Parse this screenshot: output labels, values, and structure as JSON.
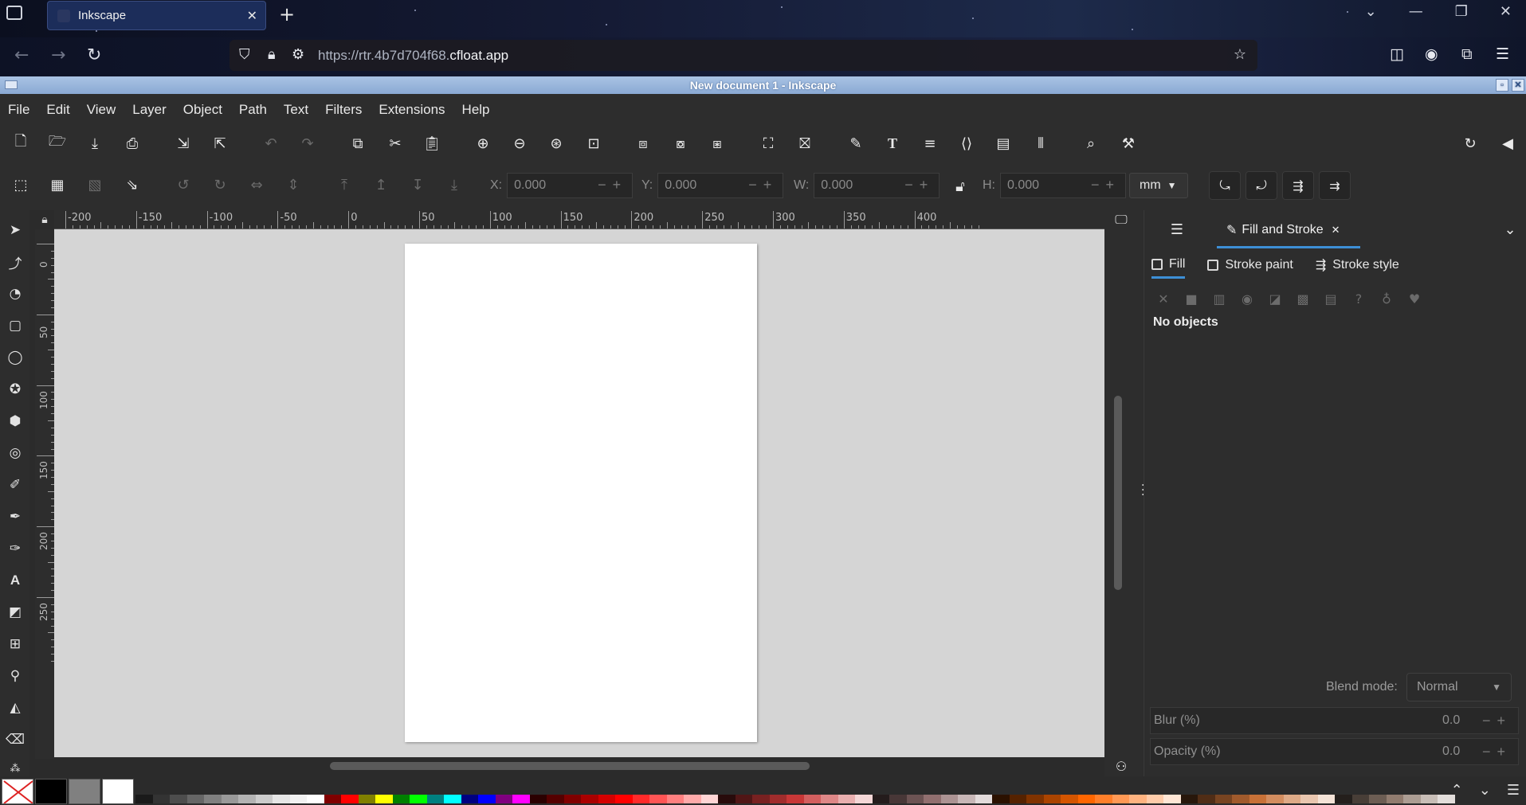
{
  "browser": {
    "tab_title": "Inkscape",
    "url_prefix": "https://rtr.4b7d704f68.",
    "url_host": "cfloat.app"
  },
  "window": {
    "title": "New document 1 - Inkscape"
  },
  "menu": [
    "File",
    "Edit",
    "View",
    "Layer",
    "Object",
    "Path",
    "Text",
    "Filters",
    "Extensions",
    "Help"
  ],
  "toolbar2": {
    "x_label": "X:",
    "x_value": "0.000",
    "y_label": "Y:",
    "y_value": "0.000",
    "w_label": "W:",
    "w_value": "0.000",
    "h_label": "H:",
    "h_value": "0.000",
    "unit": "mm"
  },
  "rulers": {
    "top_labels": [
      "-200",
      "-150",
      "-100",
      "-50",
      "0",
      "50",
      "100",
      "150",
      "200",
      "250",
      "300",
      "350",
      "400"
    ],
    "left_labels": [
      "0",
      "50",
      "100",
      "150",
      "200",
      "250"
    ]
  },
  "dock": {
    "active_tab": "Fill and Stroke",
    "subtabs": [
      "Fill",
      "Stroke paint",
      "Stroke style"
    ],
    "status": "No objects",
    "blend_label": "Blend mode:",
    "blend_value": "Normal",
    "blur_label": "Blur (%)",
    "blur_value": "0.0",
    "opacity_label": "Opacity (%)",
    "opacity_value": "0.0"
  },
  "palette": {
    "swatch_colors": [
      "#1a1a1a",
      "#333333",
      "#4d4d4d",
      "#666666",
      "#808080",
      "#999999",
      "#b3b3b3",
      "#cccccc",
      "#e6e6e6",
      "#f2f2f2",
      "#ffffff",
      "#800000",
      "#ff0000",
      "#808000",
      "#ffff00",
      "#008000",
      "#00ff00",
      "#008080",
      "#00ffff",
      "#000080",
      "#0000ff",
      "#800080",
      "#ff00ff",
      "#2b0000",
      "#550000",
      "#800000",
      "#aa0000",
      "#d40000",
      "#ff0000",
      "#ff2a2a",
      "#ff5555",
      "#ff8080",
      "#ffaaaa",
      "#ffd5d5",
      "#280b0b",
      "#501616",
      "#782121",
      "#a02c2c",
      "#c83737",
      "#d35f5f",
      "#de8787",
      "#e9afaf",
      "#f4d7d7",
      "#241c1c",
      "#483737",
      "#6c5353",
      "#916f6f",
      "#ac9393",
      "#c8b7b7",
      "#e3dbdb",
      "#2b1100",
      "#552200",
      "#803300",
      "#aa4400",
      "#d45500",
      "#ff6600",
      "#ff7f2a",
      "#ff9955",
      "#ffb380",
      "#ffccaa",
      "#ffe6d5",
      "#28170b",
      "#502d16",
      "#784421",
      "#a05a2c",
      "#c87137",
      "#d38d5f",
      "#deaa87",
      "#e9c6af",
      "#f4e3d7",
      "#241f1c",
      "#483e37",
      "#6c5d53",
      "#917c6f",
      "#ac9d93",
      "#c8beb7",
      "#e3dedb"
    ]
  }
}
